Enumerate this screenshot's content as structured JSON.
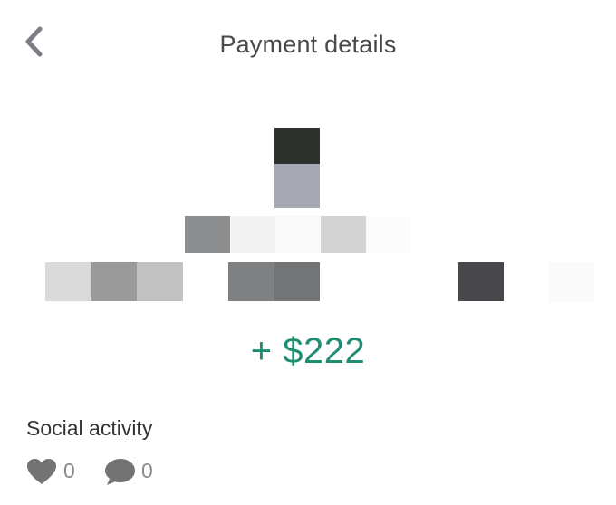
{
  "header": {
    "title": "Payment details",
    "back_icon": "chevron-left-icon"
  },
  "payment": {
    "amount": "+ $222",
    "amount_color": "#1f8d72"
  },
  "social": {
    "label": "Social activity",
    "likes": "0",
    "comments": "0",
    "like_icon": "heart-icon",
    "comment_icon": "comment-bubble-icon"
  }
}
